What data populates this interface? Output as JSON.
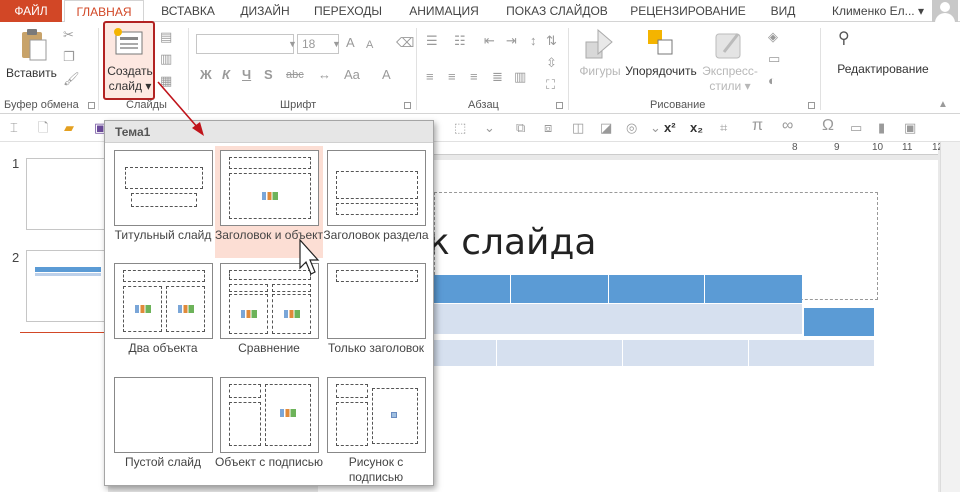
{
  "tabs": {
    "file": "ФАЙЛ",
    "home": "ГЛАВНАЯ",
    "insert": "ВСТАВКА",
    "design": "ДИЗАЙН",
    "transitions": "ПЕРЕХОДЫ",
    "animations": "АНИМАЦИЯ",
    "slideshow": "ПОКАЗ СЛАЙДОВ",
    "review": "РЕЦЕНЗИРОВАНИЕ",
    "view": "ВИД"
  },
  "user": {
    "name": "Клименко Ел...",
    "dropdown": "▾"
  },
  "ribbon": {
    "clipboard": {
      "paste": "Вставить",
      "label": "Буфер обмена"
    },
    "slides": {
      "new_slide_line1": "Создать",
      "new_slide_line2": "слайд ▾",
      "label": "Слайды"
    },
    "font": {
      "size": "18",
      "label": "Шрифт",
      "bold": "Ж",
      "italic": "К",
      "underline": "Ч",
      "strike": "S",
      "spacing": "abc",
      "font_color": "A"
    },
    "paragraph": {
      "label": "Абзац"
    },
    "drawing": {
      "shapes": "Фигуры",
      "arrange": "Упорядочить",
      "quick_styles_1": "Экспресс-",
      "quick_styles_2": "стили ▾",
      "label": "Рисование"
    },
    "editing": {
      "label": "Редактирование"
    }
  },
  "qbar": {
    "superscript": "x²",
    "subscript": "x₂",
    "pi": "π",
    "infinity": "∞",
    "omega": "Ω"
  },
  "thumbnails": [
    {
      "num": "1"
    },
    {
      "num": "2"
    }
  ],
  "ruler": {
    "ticks": [
      "8",
      "9",
      "10",
      "11",
      "12"
    ]
  },
  "slide": {
    "title": "к слайда"
  },
  "gallery": {
    "header": "Тема1",
    "layouts": [
      {
        "label": "Титульный слайд"
      },
      {
        "label": "Заголовок и объект",
        "hover": true
      },
      {
        "label": "Заголовок раздела"
      },
      {
        "label": "Два объекта"
      },
      {
        "label": "Сравнение"
      },
      {
        "label": "Только заголовок"
      },
      {
        "label": "Пустой слайд"
      },
      {
        "label": "Объект с подписью"
      },
      {
        "label": "Рисунок с подписью"
      }
    ]
  },
  "colors": {
    "accent": "#d24726",
    "highlight": "#b22222",
    "table_header": "#5b9bd5",
    "table_row": "#d6e0ef",
    "hover": "#fcded4"
  }
}
